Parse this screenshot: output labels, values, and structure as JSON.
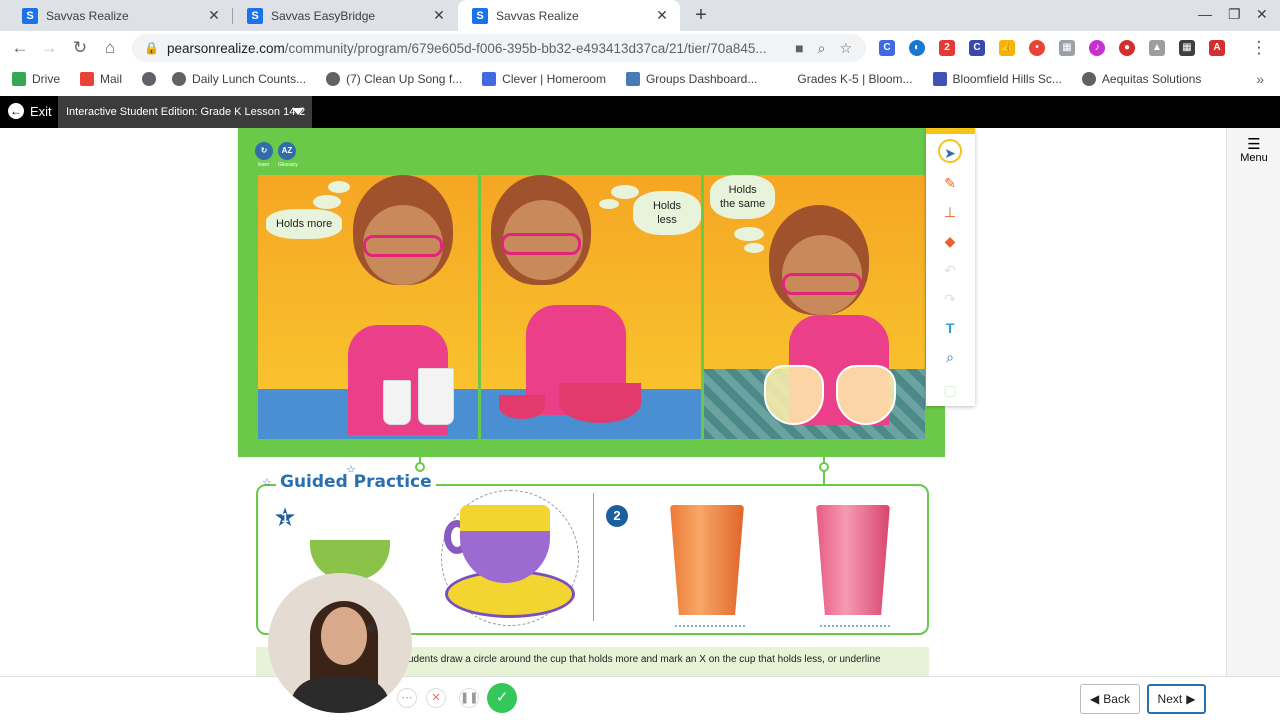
{
  "browser": {
    "tabs": [
      {
        "title": "Savvas Realize",
        "favicon": "S"
      },
      {
        "title": "Savvas EasyBridge",
        "favicon": "S"
      },
      {
        "title": "Savvas Realize",
        "favicon": "S"
      }
    ],
    "url_host": "pearsonrealize.com",
    "url_path": "/community/program/679e605d-f006-395b-bb32-e493413d37ca/21/tier/70a845...",
    "bookmarks": [
      {
        "label": "Drive",
        "icon": "drive-icon",
        "color": "#34a853"
      },
      {
        "label": "Mail",
        "icon": "gmail-icon",
        "color": "#ea4335"
      },
      {
        "label": "",
        "icon": "globe-icon",
        "color": "#5f6368"
      },
      {
        "label": "Daily Lunch Counts...",
        "icon": "globe-icon",
        "color": "#5f6368"
      },
      {
        "label": "(7) Clean Up Song f...",
        "icon": "globe-icon",
        "color": "#5f6368"
      },
      {
        "label": "Clever | Homeroom",
        "icon": "clever-icon",
        "color": "#4169e1"
      },
      {
        "label": "Groups Dashboard...",
        "icon": "bb-icon",
        "color": "#4a7ab5"
      },
      {
        "label": "Grades K-5 | Bloom...",
        "icon": "blank-icon",
        "color": "#ffffff"
      },
      {
        "label": "Bloomfield Hills Sc...",
        "icon": "four-icon",
        "color": "#3f51b5"
      },
      {
        "label": "Aequitas Solutions",
        "icon": "globe-icon",
        "color": "#5f6368"
      }
    ]
  },
  "app": {
    "exit_label": "Exit",
    "lesson_title": "Interactive Student Edition: Grade K Lesson 14-2",
    "menu_label": "Menu",
    "scene_icons": [
      {
        "text": "",
        "label": "learn"
      },
      {
        "text": "AZ",
        "label": "Glossary"
      }
    ],
    "scene": {
      "panel1": "Holds more",
      "panel2": "Holds less",
      "panel3_line1": "Holds",
      "panel3_line2": "the same"
    },
    "guided_title": "Guided Practice",
    "problem_numbers": [
      "1",
      "2"
    ],
    "directions": "udents draw a circle around the cup that holds more and mark an X on the cup that holds less, or underline",
    "back_label": "Back",
    "next_label": "Next"
  },
  "colors": {
    "scene_green": "#6bc94a",
    "accent_blue": "#2a6fb0",
    "record_green": "#34c759"
  }
}
